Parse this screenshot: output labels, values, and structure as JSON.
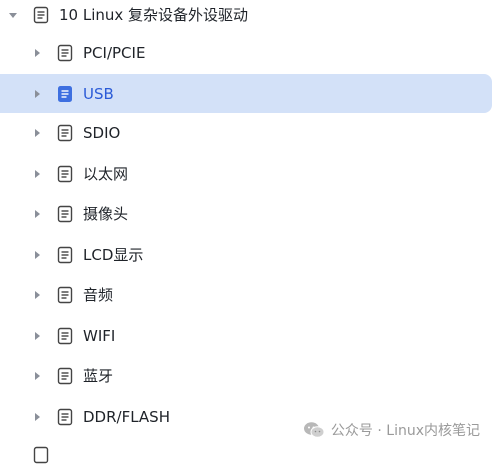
{
  "tree": {
    "parent": {
      "label": "10 Linux 复杂设备外设驱动"
    },
    "children": [
      {
        "label": "PCI/PCIE"
      },
      {
        "label": "USB",
        "selected": true
      },
      {
        "label": "SDIO"
      },
      {
        "label": "以太网"
      },
      {
        "label": "摄像头"
      },
      {
        "label": "LCD显示"
      },
      {
        "label": "音频"
      },
      {
        "label": "WIFI"
      },
      {
        "label": "蓝牙"
      },
      {
        "label": "DDR/FLASH"
      }
    ]
  },
  "watermark": {
    "text": "公众号 · Linux内核笔记"
  },
  "icons": {
    "expanded_caret": "chevron-down-icon",
    "collapsed_caret": "chevron-right-icon",
    "document": "document-icon",
    "watermark_logo": "wechat-icon"
  },
  "colors": {
    "selected_bg": "#d3e1f8",
    "selected_text": "#2b5bd7",
    "text": "#1f2329",
    "caret": "#8a8f99"
  }
}
